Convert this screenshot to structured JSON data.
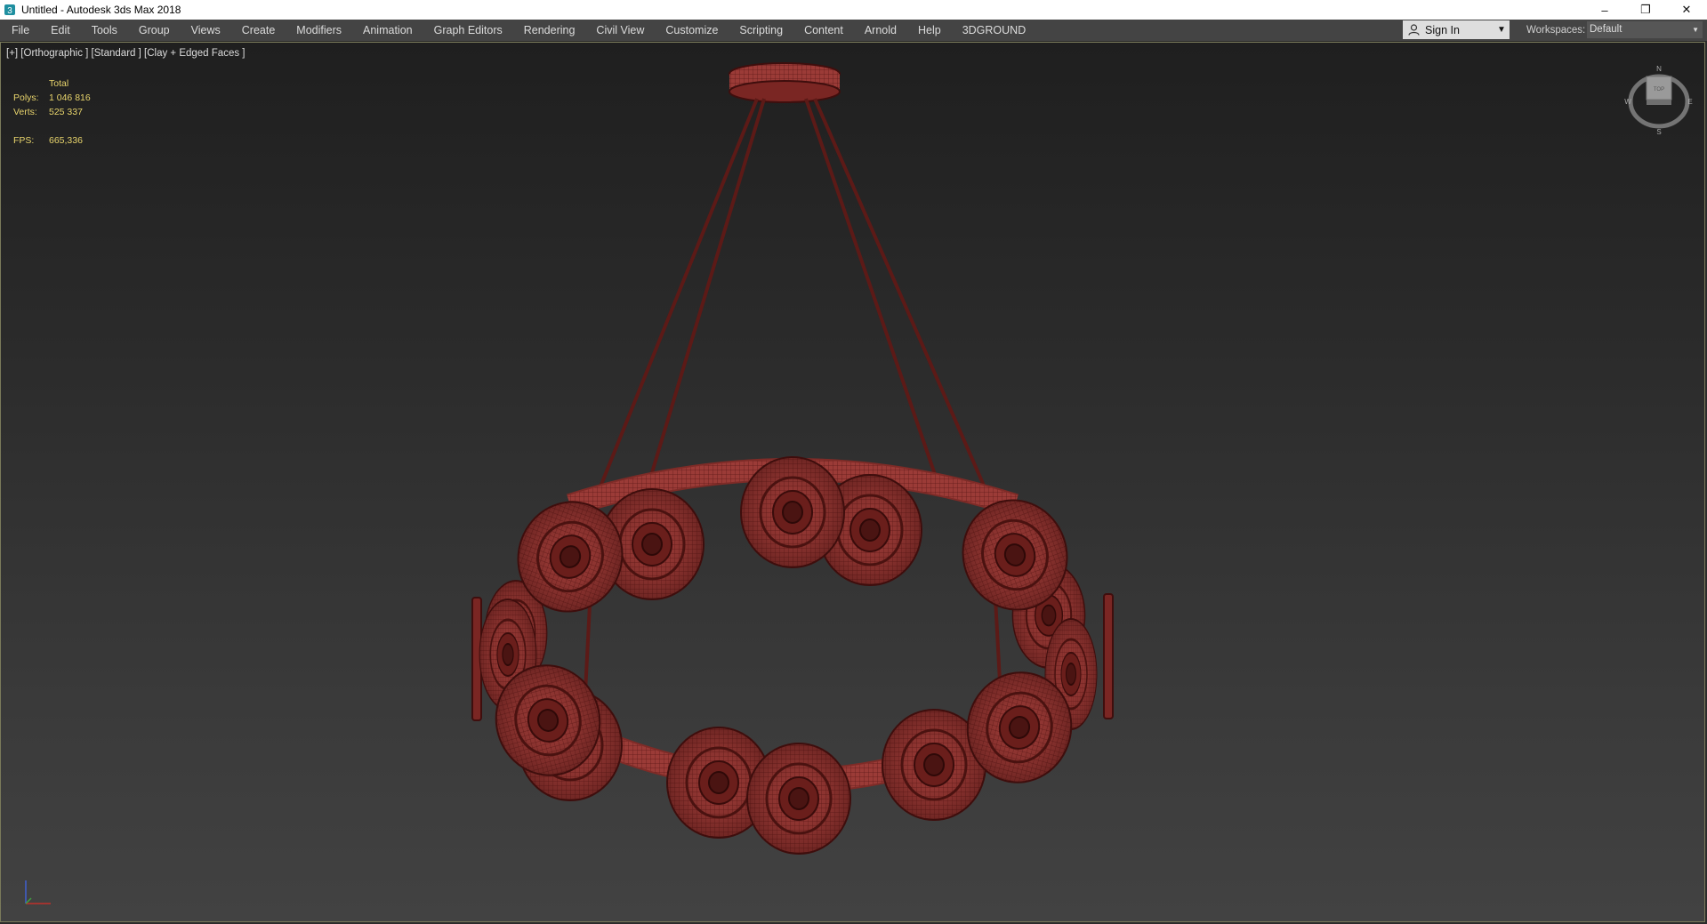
{
  "window": {
    "title": "Untitled - Autodesk 3ds Max 2018",
    "icon": "3dsmax-app-icon",
    "controls": {
      "minimize": "–",
      "restore": "❐",
      "close": "✕"
    }
  },
  "menu": [
    "File",
    "Edit",
    "Tools",
    "Group",
    "Views",
    "Create",
    "Modifiers",
    "Animation",
    "Graph Editors",
    "Rendering",
    "Civil View",
    "Customize",
    "Scripting",
    "Content",
    "Arnold",
    "Help",
    "3DGROUND"
  ],
  "signin": {
    "label": "Sign In",
    "icon": "user-icon",
    "caret": "▼"
  },
  "workspaces": {
    "label": "Workspaces:",
    "value": "Default",
    "caret": "▼"
  },
  "viewport": {
    "label": "[+] [Orthographic ] [Standard ] [Clay + Edged Faces ]",
    "stats": {
      "header": "Total",
      "polys_label": "Polys:",
      "polys_value": "1 046 816",
      "verts_label": "Verts:",
      "verts_value": "525 337",
      "fps_label": "FPS:",
      "fps_value": "665,336"
    },
    "viewcube": {
      "n": "N",
      "s": "S",
      "e": "E",
      "w": "W",
      "face": "TOP"
    }
  },
  "colors": {
    "model": "#9a3a37",
    "model_dark": "#5a1614",
    "stats": "#e9d56c"
  }
}
